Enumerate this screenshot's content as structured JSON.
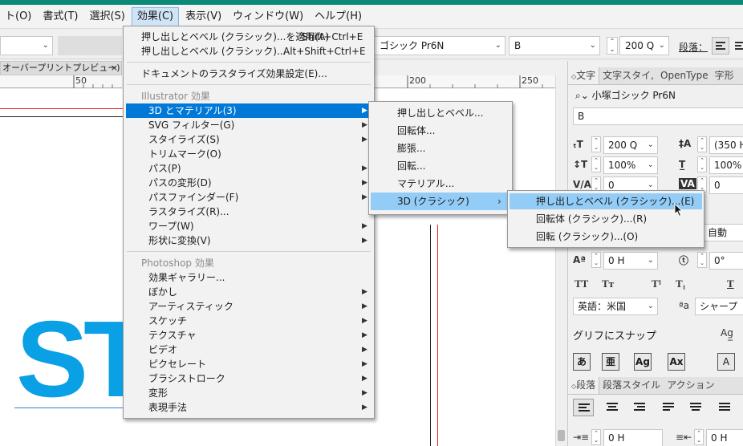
{
  "menubar": {
    "items": [
      "ト(O)",
      "書式(T)",
      "選択(S)",
      "効果(C)",
      "表示(V)",
      "ウィンドウ(W)",
      "ヘルプ(H)"
    ]
  },
  "controlbar": {
    "font_family": "ゴシック Pr6N",
    "font_style": "B",
    "font_size": "200 Q",
    "paragraph_label": "段落："
  },
  "document": {
    "tab_title": "オーバープリントプレビュー)",
    "tab_close": "×",
    "ruler_left": [
      "50"
    ],
    "ruler_right": [
      "200",
      "250"
    ],
    "canvas_text": "ST"
  },
  "effect_menu": {
    "items": [
      {
        "label": "押し出しとベベル (クラシック)...を適用(A)",
        "shortcut": "Shift+Ctrl+E"
      },
      {
        "label": "押し出しとベベル (クラシック)...",
        "shortcut": "Alt+Shift+Ctrl+E"
      },
      {
        "label": "ドキュメントのラスタライズ効果設定(E)..."
      },
      {
        "label": "Illustrator 効果",
        "header": true
      },
      {
        "label": "3D とマテリアル(3)",
        "submenu": true,
        "highlighted": true
      },
      {
        "label": "SVG フィルター(G)",
        "submenu": true
      },
      {
        "label": "スタイライズ(S)",
        "submenu": true
      },
      {
        "label": "トリムマーク(O)"
      },
      {
        "label": "パス(P)",
        "submenu": true
      },
      {
        "label": "パスの変形(D)",
        "submenu": true
      },
      {
        "label": "パスファインダー(F)",
        "submenu": true
      },
      {
        "label": "ラスタライズ(R)..."
      },
      {
        "label": "ワープ(W)",
        "submenu": true
      },
      {
        "label": "形状に変換(V)",
        "submenu": true
      },
      {
        "label": "Photoshop 効果",
        "header": true
      },
      {
        "label": "効果ギャラリー..."
      },
      {
        "label": "ぼかし",
        "submenu": true
      },
      {
        "label": "アーティスティック",
        "submenu": true
      },
      {
        "label": "スケッチ",
        "submenu": true
      },
      {
        "label": "テクスチャ",
        "submenu": true
      },
      {
        "label": "ビデオ",
        "submenu": true
      },
      {
        "label": "ピクセレート",
        "submenu": true
      },
      {
        "label": "ブラシストローク",
        "submenu": true
      },
      {
        "label": "変形",
        "submenu": true
      },
      {
        "label": "表現手法",
        "submenu": true
      }
    ]
  },
  "submenu_3d": {
    "items": [
      {
        "label": "押し出しとベベル..."
      },
      {
        "label": "回転体..."
      },
      {
        "label": "膨張..."
      },
      {
        "label": "回転..."
      },
      {
        "label": "マテリアル..."
      },
      {
        "label": "3D (クラシック)",
        "submenu": true,
        "highlighted": true
      }
    ]
  },
  "submenu_classic": {
    "items": [
      {
        "label": "押し出しとベベル (クラシック)...(E)",
        "highlighted": true
      },
      {
        "label": "回転体 (クラシック)...(R)"
      },
      {
        "label": "回転 (クラシック)...(O)"
      }
    ]
  },
  "char_panel": {
    "tabs": [
      "文字",
      "文字スタイ,",
      "OpenType",
      "字形"
    ],
    "font_family": "小塚ゴシック Pr6N",
    "font_style": "B",
    "size": "200 Q",
    "leading": "(350 H",
    "vscale": "100%",
    "hscale": "100%",
    "kerning": "0",
    "tracking": "0",
    "auto_label": "自動",
    "baseline": "0 H",
    "rotation": "0°",
    "style_buttons": [
      "TT",
      "Tт",
      "T¹",
      "T₁",
      "T"
    ],
    "language": "英語：米国",
    "antialias": "シャープ",
    "snap_label": "グリフにスナップ",
    "snap_icons": [
      "あ",
      "亜",
      "Ag",
      "Ax",
      "A"
    ]
  },
  "para_panel": {
    "tabs": [
      "段落",
      "段落スタイル",
      "アクション"
    ],
    "indent_left": "0 H",
    "indent_right": "0 H"
  },
  "colors": {
    "accent": "#0b8a78",
    "highlight": "#0078d7",
    "hover": "#93cdf7",
    "canvas_text": "#0aa0e6"
  }
}
